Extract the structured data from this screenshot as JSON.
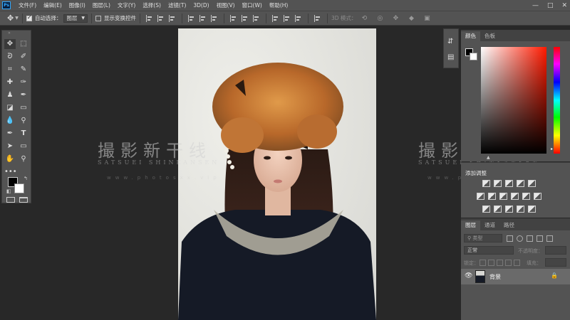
{
  "menubar": {
    "logo": "Ps",
    "items": [
      "文件(F)",
      "编辑(E)",
      "图像(I)",
      "图层(L)",
      "文字(Y)",
      "选择(S)",
      "滤镜(T)",
      "3D(D)",
      "视图(V)",
      "窗口(W)",
      "帮助(H)"
    ],
    "window_controls": [
      "—",
      "□",
      "✕"
    ]
  },
  "options": {
    "auto_select_label": "自动选择：",
    "auto_select_checked": true,
    "auto_select_value": "图层",
    "show_transform_label": "显示变换控件",
    "show_transform_checked": false,
    "mode3d_label": "3D 模式："
  },
  "watermark": {
    "title": "撮影新干线",
    "subtitle": "SATSUEI SHINKANSEN",
    "url": "www.photosxx.vip"
  },
  "color_panel": {
    "tabs": [
      "颜色",
      "色板"
    ],
    "active_tab": "颜色",
    "foreground": "#000000",
    "background": "#ffffff",
    "hue": "#ff1a00"
  },
  "adjustments_panel": {
    "title": "添加调整"
  },
  "layers_panel": {
    "tabs": [
      "图层",
      "通道",
      "路径"
    ],
    "active_tab": "图层",
    "filter_placeholder": "类型",
    "blend_mode": "正常",
    "opacity_label": "不透明度：",
    "lock_label": "锁定：",
    "fill_label": "填充：",
    "layer": {
      "name": "背景",
      "visible": true,
      "locked": true
    }
  }
}
